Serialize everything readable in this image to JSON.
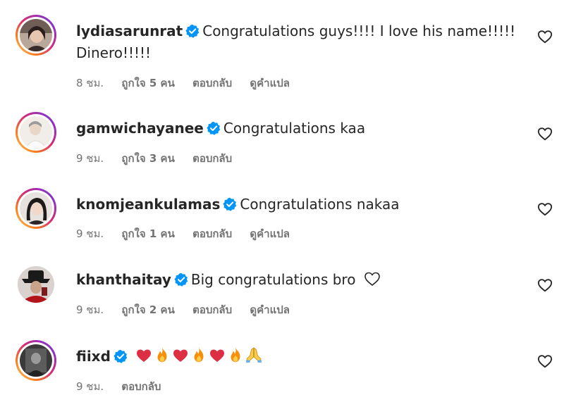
{
  "comments": [
    {
      "username": "lydiasarunrat",
      "text_line1": "Congratulations guys!!!! I love his name!!!!!",
      "text_line2": "Dinero!!!!!",
      "time": "8 ชม.",
      "likes": "ถูกใจ 5 คน",
      "reply": "ตอบกลับ",
      "translate": "ดูคำแปล"
    },
    {
      "username": "gamwichayanee",
      "text": "Congratulations kaa",
      "time": "9 ชม.",
      "likes": "ถูกใจ 3 คน",
      "reply": "ตอบกลับ"
    },
    {
      "username": "knomjeankulamas",
      "text": "Congratulations nakaa",
      "time": "9 ชม.",
      "likes": "ถูกใจ 1 คน",
      "reply": "ตอบกลับ",
      "translate": "ดูคำแปล"
    },
    {
      "username": "khanthaitay",
      "text": "Big congratulations bro",
      "time": "9 ชม.",
      "likes": "ถูกใจ 2 คน",
      "reply": "ตอบกลับ",
      "translate": "ดูคำแปล"
    },
    {
      "username": "fiixd",
      "emojis": [
        "red-heart",
        "fire",
        "red-heart",
        "fire",
        "red-heart",
        "fire",
        "folded-hands"
      ],
      "time": "9 ชม.",
      "reply": "ตอบกลับ"
    }
  ],
  "colors": {
    "text": "#262626",
    "meta": "#737373",
    "verified": "#0095f6",
    "heart": "#e0245e",
    "fire": "#f4900c"
  }
}
